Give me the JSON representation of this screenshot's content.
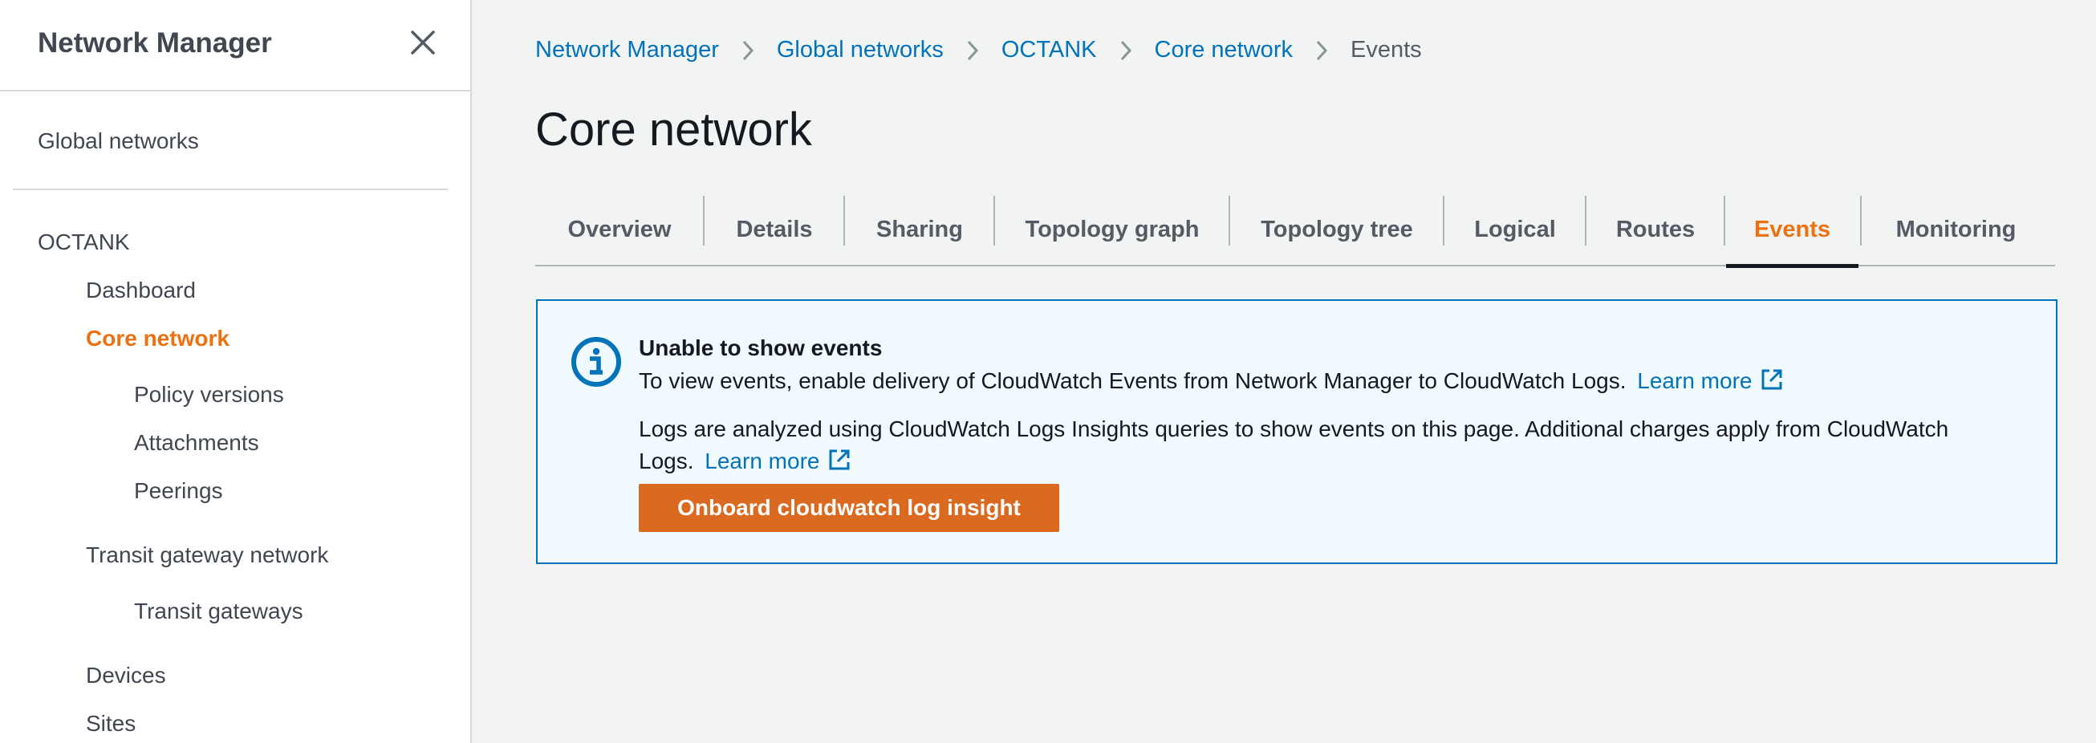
{
  "sidebar": {
    "title": "Network Manager",
    "items": [
      {
        "label": "Global networks"
      },
      {
        "label": "OCTANK"
      },
      {
        "label": "Dashboard"
      },
      {
        "label": "Core network"
      },
      {
        "label": "Policy versions"
      },
      {
        "label": "Attachments"
      },
      {
        "label": "Peerings"
      },
      {
        "label": "Transit gateway network"
      },
      {
        "label": "Transit gateways"
      },
      {
        "label": "Devices"
      },
      {
        "label": "Sites"
      }
    ],
    "active_item": "Core network"
  },
  "breadcrumb": {
    "items": [
      "Network Manager",
      "Global networks",
      "OCTANK",
      "Core network"
    ],
    "current": "Events"
  },
  "page_title": "Core network",
  "tabs": [
    {
      "label": "Overview"
    },
    {
      "label": "Details"
    },
    {
      "label": "Sharing"
    },
    {
      "label": "Topology graph"
    },
    {
      "label": "Topology tree"
    },
    {
      "label": "Logical"
    },
    {
      "label": "Routes"
    },
    {
      "label": "Events"
    },
    {
      "label": "Monitoring"
    }
  ],
  "active_tab": "Events",
  "alert": {
    "title": "Unable to show events",
    "line1": "To view events, enable delivery of CloudWatch Events from Network Manager to CloudWatch Logs.",
    "line2": "Logs are analyzed using CloudWatch Logs Insights queries to show events on this page. Additional charges apply from CloudWatch",
    "line3": "Logs.",
    "learn_more": "Learn more",
    "button_label": "Onboard cloudwatch log insight"
  },
  "colors": {
    "accent": "#ec7211",
    "link": "#0073bb",
    "alert_bg": "#f1faff",
    "button": "#d96a1f"
  },
  "icons": {
    "close": "close-icon",
    "separator": "chevron-right-icon",
    "info": "info-icon",
    "external": "external-link-icon"
  }
}
